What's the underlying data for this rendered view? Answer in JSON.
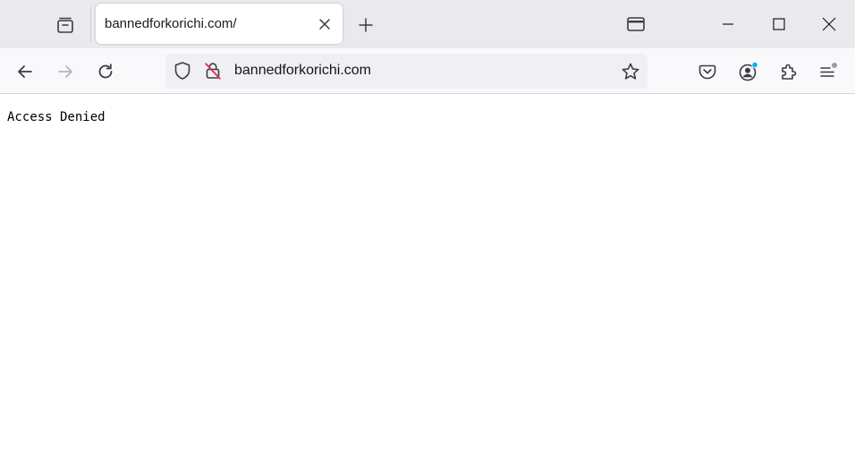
{
  "browser": {
    "tab": {
      "title": "bannedforkorichi.com/"
    },
    "urlbar": {
      "url": "bannedforkorichi.com"
    },
    "icons": {
      "tab_manager": "tab-manager-icon",
      "tab_close": "close-icon",
      "new_tab": "plus-icon",
      "list_all_tabs": "list-all-tabs-icon",
      "back": "arrow-left-icon",
      "forward": "arrow-right-icon",
      "reload": "reload-icon",
      "tracking_protection": "shield-icon",
      "connection": "insecure-lock-icon",
      "bookmark": "star-icon",
      "pocket": "pocket-icon",
      "account": "account-icon",
      "extensions": "puzzle-piece-icon",
      "menu": "hamburger-menu-icon"
    },
    "colors": {
      "titlebar_bg": "#eae9ee",
      "toolbar_bg": "#f9f9fb",
      "urlbar_bg": "#f0f0f4",
      "insecure_slash": "#e22850",
      "account_badge": "#00b3f4",
      "menu_badge": "#9e9ea6"
    }
  },
  "page": {
    "message": "Access Denied"
  }
}
